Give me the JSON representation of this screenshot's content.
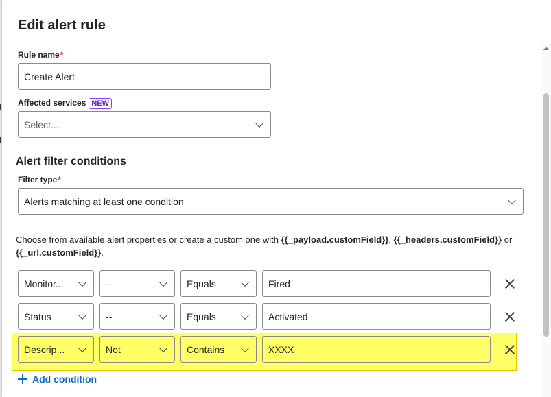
{
  "dialog": {
    "title": "Edit alert rule"
  },
  "rule_name": {
    "label": "Rule name",
    "required_mark": "*",
    "value": "Create Alert"
  },
  "affected_services": {
    "label": "Affected services",
    "badge": "NEW",
    "placeholder": "Select..."
  },
  "filter_section": {
    "title": "Alert filter conditions",
    "filter_type_label": "Filter type",
    "required_mark": "*",
    "filter_type_value": "Alerts matching at least one condition",
    "help_text_prefix": "Choose from available alert properties or create a custom one with ",
    "help_token_payload": "{{_payload.customField}}",
    "help_sep": ", ",
    "help_token_headers": "{{_headers.customField}}",
    "help_or": " or ",
    "help_token_url": "{{_url.customField}}",
    "help_end": "."
  },
  "conditions": [
    {
      "property": "Monitor...",
      "modifier": "--",
      "operator": "Equals",
      "value": "Fired"
    },
    {
      "property": "Status",
      "modifier": "--",
      "operator": "Equals",
      "value": "Activated"
    },
    {
      "property": "Descrip...",
      "modifier": "Not",
      "operator": "Contains",
      "value": "XXXX"
    }
  ],
  "add_condition_label": "Add condition",
  "colors": {
    "highlight": "#ffff66",
    "link": "#0f6cbd",
    "required": "#c50f1f",
    "badge_border": "#8a3ffc"
  }
}
